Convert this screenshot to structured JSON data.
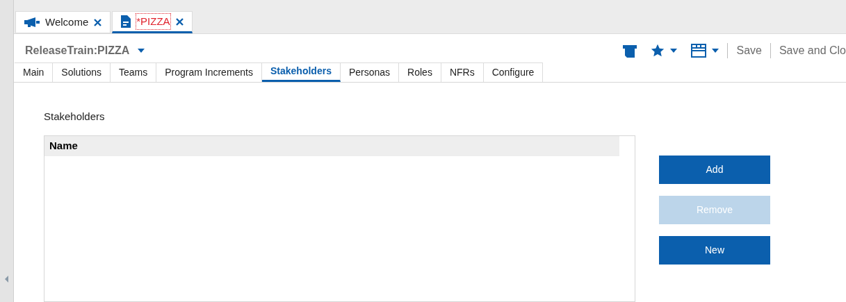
{
  "editor_tabs": [
    {
      "label": "Welcome",
      "kind": "megaphone",
      "modified": false,
      "selected": false
    },
    {
      "label": "*PIZZA",
      "kind": "document",
      "modified": true,
      "selected": true
    }
  ],
  "title": "ReleaseTrain:PIZZA",
  "toolbar": {
    "actions": [
      "Save",
      "Save and Clo"
    ]
  },
  "tabs": [
    {
      "label": "Main",
      "selected": false
    },
    {
      "label": "Solutions",
      "selected": false
    },
    {
      "label": "Teams",
      "selected": false
    },
    {
      "label": "Program Increments",
      "selected": false
    },
    {
      "label": "Stakeholders",
      "selected": true
    },
    {
      "label": "Personas",
      "selected": false
    },
    {
      "label": "Roles",
      "selected": false
    },
    {
      "label": "NFRs",
      "selected": false
    },
    {
      "label": "Configure",
      "selected": false
    }
  ],
  "section_title": "Stakeholders",
  "table": {
    "columns": [
      "Name"
    ]
  },
  "buttons": [
    {
      "label": "Add",
      "disabled": false
    },
    {
      "label": "Remove",
      "disabled": true
    },
    {
      "label": "New",
      "disabled": false
    }
  ]
}
